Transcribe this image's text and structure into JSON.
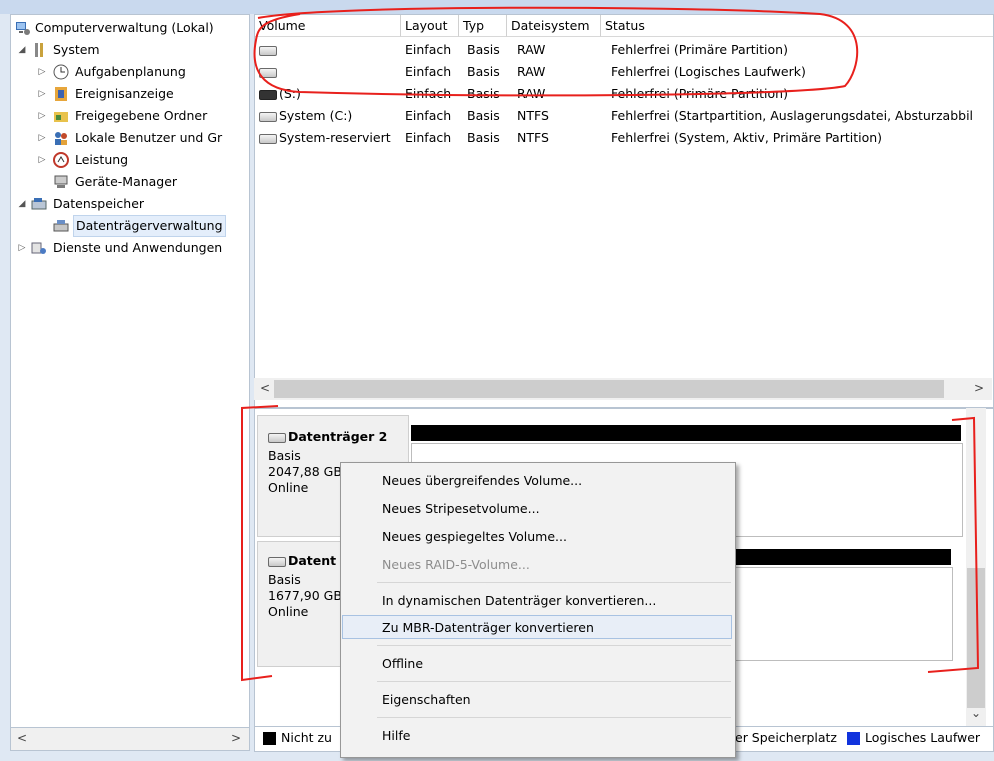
{
  "tree": {
    "items": [
      {
        "label": "Computerverwaltung (Lokal)",
        "expander": "",
        "icon": "computer-management-icon"
      },
      {
        "label": "System",
        "expander": "◢",
        "icon": "tools-icon"
      },
      {
        "label": "Aufgabenplanung",
        "expander": "▷",
        "icon": "clock-icon"
      },
      {
        "label": "Ereignisanzeige",
        "expander": "▷",
        "icon": "event-viewer-icon"
      },
      {
        "label": "Freigegebene Ordner",
        "expander": "▷",
        "icon": "shared-folder-icon"
      },
      {
        "label": "Lokale Benutzer und Gr",
        "expander": "▷",
        "icon": "users-icon"
      },
      {
        "label": "Leistung",
        "expander": "▷",
        "icon": "performance-icon"
      },
      {
        "label": "Geräte-Manager",
        "expander": "",
        "icon": "device-manager-icon"
      },
      {
        "label": "Datenspeicher",
        "expander": "◢",
        "icon": "storage-icon"
      },
      {
        "label": "Datenträgerverwaltung",
        "expander": "",
        "icon": "disk-management-icon"
      },
      {
        "label": "Dienste und Anwendungen",
        "expander": "▷",
        "icon": "services-icon"
      }
    ]
  },
  "volume_table": {
    "columns": [
      "Volume",
      "Layout",
      "Typ",
      "Dateisystem",
      "Status"
    ],
    "rows": [
      {
        "volume": "",
        "layout": "Einfach",
        "typ": "Basis",
        "fs": "RAW",
        "status": "Fehlerfrei (Primäre Partition)"
      },
      {
        "volume": "",
        "layout": "Einfach",
        "typ": "Basis",
        "fs": "RAW",
        "status": "Fehlerfrei (Logisches Laufwerk)"
      },
      {
        "volume": "(S:)",
        "layout": "Einfach",
        "typ": "Basis",
        "fs": "RAW",
        "status": "Fehlerfrei (Primäre Partition)"
      },
      {
        "volume": "System (C:)",
        "layout": "Einfach",
        "typ": "Basis",
        "fs": "NTFS",
        "status": "Fehlerfrei (Startpartition, Auslagerungsdatei, Absturzabbil"
      },
      {
        "volume": "System-reserviert",
        "layout": "Einfach",
        "typ": "Basis",
        "fs": "NTFS",
        "status": "Fehlerfrei (System, Aktiv, Primäre Partition)"
      }
    ]
  },
  "disks": [
    {
      "name": "Datenträger 2",
      "type": "Basis",
      "size": "2047,88 GB",
      "state": "Online"
    },
    {
      "name": "Datent",
      "type": "Basis",
      "size": "1677,90 GB",
      "state": "Online"
    }
  ],
  "legend": {
    "left_label": "Nicht zu",
    "right_label1": "er Speicherplatz",
    "right_label2": "Logisches Laufwer",
    "colors": {
      "unallocated": "#000000",
      "logical": "#1133dd"
    }
  },
  "context_menu": {
    "items": [
      {
        "label": "Neues übergreifendes Volume...",
        "disabled": false
      },
      {
        "label": "Neues Stripesetvolume...",
        "disabled": false
      },
      {
        "label": "Neues gespiegeltes Volume...",
        "disabled": false
      },
      {
        "label": "Neues RAID-5-Volume...",
        "disabled": true
      },
      {
        "label": "In dynamischen Datenträger konvertieren...",
        "disabled": false
      },
      {
        "label": "Zu MBR-Datenträger konvertieren",
        "disabled": false,
        "highlighted": true
      },
      {
        "label": "Offline",
        "disabled": false
      },
      {
        "label": "Eigenschaften",
        "disabled": false
      },
      {
        "label": "Hilfe",
        "disabled": false
      }
    ]
  },
  "annotation_color": "#e8201c"
}
